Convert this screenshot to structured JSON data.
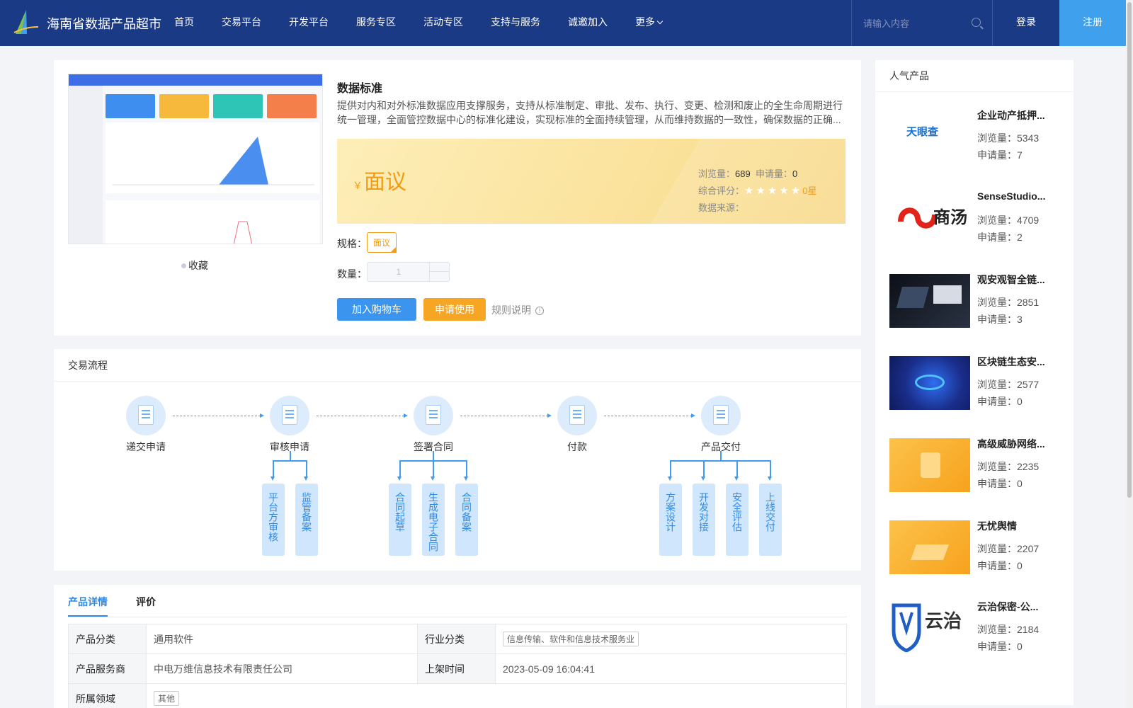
{
  "header": {
    "brand": "海南省数据产品超市",
    "nav": [
      "首页",
      "交易平台",
      "开发平台",
      "服务专区",
      "活动专区",
      "支持与服务",
      "诚邀加入",
      "更多"
    ],
    "search_placeholder": "请输入内容",
    "login": "登录",
    "register": "注册"
  },
  "product": {
    "title": "数据标准",
    "description": "提供对内和对外标准数据应用支撑服务，支持从标准制定、审批、发布、执行、变更、检测和废止的全生命周期进行统一管理，全面管控数据中心的标准化建设，实现标准的全面持续管理，从而维持数据的一致性，确保数据的正确...",
    "currency": "￥",
    "price": "面议",
    "views_label": "浏览量：",
    "views": "689",
    "applies_label": "申请量：",
    "applies": "0",
    "rating_label": "综合评分：",
    "rating_stars": "★★★★★",
    "rating_text": "0星",
    "source_label": "数据来源：",
    "spec_label": "规格：",
    "spec_value": "面议",
    "qty_label": "数量：",
    "qty_value": "1",
    "favorite": "收藏",
    "add_cart": "加入购物车",
    "apply": "申请使用",
    "rules": "规则说明"
  },
  "flow": {
    "title": "交易流程",
    "steps": [
      "递交申请",
      "审核申请",
      "签署合同",
      "付款",
      "产品交付"
    ],
    "sub_audit": [
      "平台方审核",
      "监管备案"
    ],
    "sub_contract": [
      "合同起草",
      "生成电子合同",
      "合同备案"
    ],
    "sub_delivery": [
      "方案设计",
      "开发对接",
      "安全评估",
      "上线交付"
    ]
  },
  "detail": {
    "tabs": [
      "产品详情",
      "评价"
    ],
    "rows": [
      {
        "k1": "产品分类",
        "v1": "通用软件",
        "k2": "行业分类",
        "v2": "信息传输、软件和信息技术服务业"
      },
      {
        "k1": "产品服务商",
        "v1": "中电万维信息技术有限责任公司",
        "k2": "上架时间",
        "v2": "2023-05-09 16:04:41"
      },
      {
        "k1": "所属领域",
        "v1": "其他"
      }
    ]
  },
  "popular": {
    "title": "人气产品",
    "views_label": "浏览量：",
    "applies_label": "申请量：",
    "items": [
      {
        "name": "企业动产抵押...",
        "views": "5343",
        "applies": "7",
        "logo": "天眼查"
      },
      {
        "name": "SenseStudio...",
        "views": "4709",
        "applies": "2",
        "logo": "商汤"
      },
      {
        "name": "观安观智全链...",
        "views": "2851",
        "applies": "3"
      },
      {
        "name": "区块链生态安...",
        "views": "2577",
        "applies": "0"
      },
      {
        "name": "高级威胁网络...",
        "views": "2235",
        "applies": "0"
      },
      {
        "name": "无忧舆情",
        "views": "2207",
        "applies": "0"
      },
      {
        "name": "云治保密-公...",
        "views": "2184",
        "applies": "0",
        "logo": "云治"
      }
    ]
  },
  "colors": {
    "header": "#1b3a86",
    "primary": "#3b94ee",
    "accent": "#f6a623"
  }
}
